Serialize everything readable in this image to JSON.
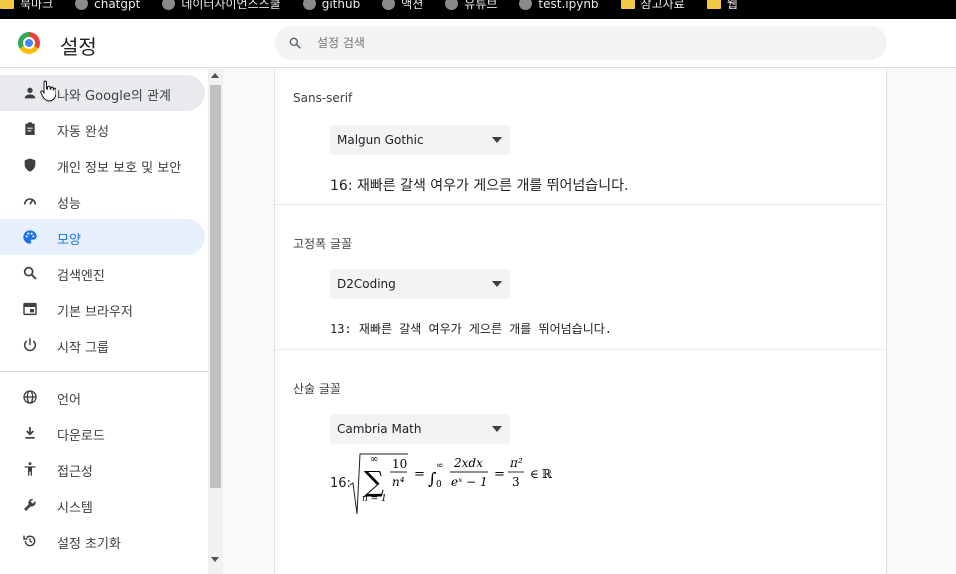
{
  "bookmarks": [
    {
      "icon": "folder-icon",
      "label": "북마크"
    },
    {
      "icon": "chatgpt-icon",
      "label": "chatgpt"
    },
    {
      "icon": "web-icon",
      "label": "데이터사이언스스쿨"
    },
    {
      "icon": "github-icon",
      "label": "github"
    },
    {
      "icon": "gear-icon",
      "label": "액션"
    },
    {
      "icon": "calendar-icon",
      "label": "유튜브"
    },
    {
      "icon": "colab-icon",
      "label": "test.ipynb"
    },
    {
      "icon": "folder-icon",
      "label": "참고자료"
    },
    {
      "icon": "folder-icon",
      "label": "웹"
    }
  ],
  "header": {
    "title": "설정",
    "search_placeholder": "설정 검색"
  },
  "sidebar": {
    "items": [
      {
        "icon": "person-icon",
        "label": "나와 Google의 관계"
      },
      {
        "icon": "clipboard-icon",
        "label": "자동 완성"
      },
      {
        "icon": "shield-icon",
        "label": "개인 정보 보호 및 보안"
      },
      {
        "icon": "speed-icon",
        "label": "성능"
      },
      {
        "icon": "palette-icon",
        "label": "모양"
      },
      {
        "icon": "search-icon",
        "label": "검색엔진"
      },
      {
        "icon": "browser-icon",
        "label": "기본 브라우저"
      },
      {
        "icon": "power-icon",
        "label": "시작 그룹"
      },
      {
        "icon": "globe-icon",
        "label": "언어"
      },
      {
        "icon": "download-icon",
        "label": "다운로드"
      },
      {
        "icon": "accessibility-icon",
        "label": "접근성"
      },
      {
        "icon": "wrench-icon",
        "label": "시스템"
      },
      {
        "icon": "history-icon",
        "label": "설정 초기화"
      }
    ],
    "selected": "모양"
  },
  "fonts": {
    "sans_serif": {
      "label": "Sans-serif",
      "value": "Malgun Gothic",
      "sample": "16: 재빠른 갈색 여우가 게으른 개를 뛰어넘습니다."
    },
    "fixed_width": {
      "label": "고정폭 글꼴",
      "value": "D2Coding",
      "sample": "13: 재빠른 갈색 여우가 게으른 개를 뛰어넘습니다."
    },
    "math": {
      "label": "산술 글꼴",
      "value": "Cambria Math",
      "sample_prefix": "16:"
    }
  },
  "colors": {
    "accent": "#1a73e8",
    "selected_bg": "#e8f0fe"
  }
}
